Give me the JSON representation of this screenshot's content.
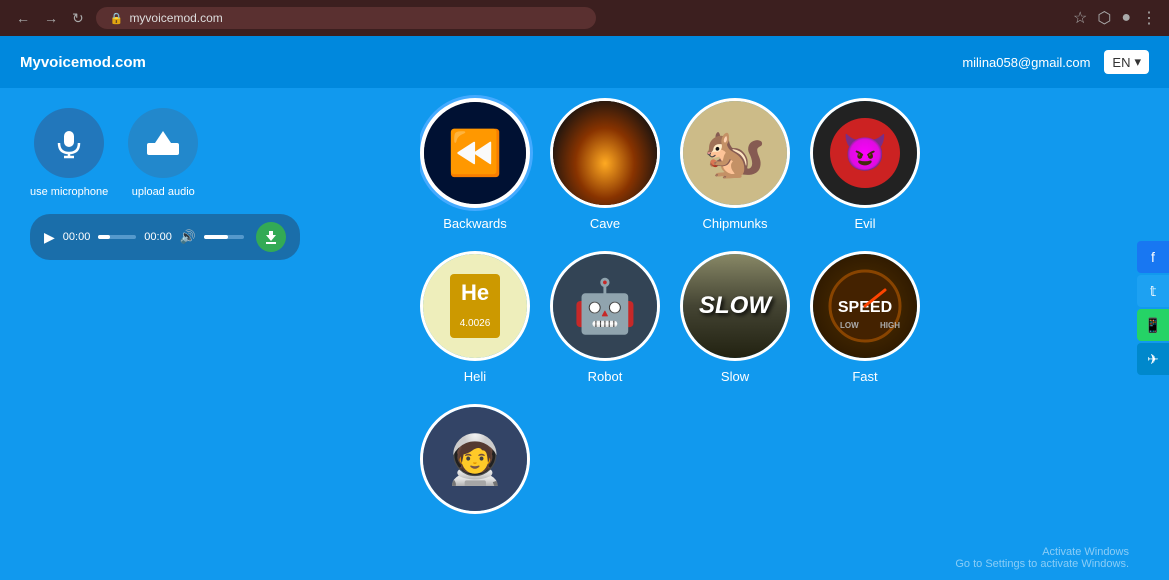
{
  "browser": {
    "url": "myvoicemod.com",
    "extensions": [
      "★",
      "≡",
      "⬡",
      "●"
    ]
  },
  "topbar": {
    "site_title": "Myvoicemod.com",
    "user_email": "milina058@gmail.com",
    "language": "EN"
  },
  "left_panel": {
    "mic_label": "use microphone",
    "upload_label": "upload audio",
    "time_start": "00:00",
    "time_end": "00:00"
  },
  "voices": {
    "row1": [
      {
        "id": "backwards",
        "label": "Backwards",
        "selected": true
      },
      {
        "id": "cave",
        "label": "Cave",
        "selected": false
      },
      {
        "id": "chipmunks",
        "label": "Chipmunks",
        "selected": false
      },
      {
        "id": "evil",
        "label": "Evil",
        "selected": false
      }
    ],
    "row2": [
      {
        "id": "heli",
        "label": "Heli",
        "selected": false
      },
      {
        "id": "robot",
        "label": "Robot",
        "selected": false
      },
      {
        "id": "slow",
        "label": "Slow",
        "selected": false
      },
      {
        "id": "fast",
        "label": "Fast",
        "selected": false
      }
    ],
    "row3": [
      {
        "id": "astronaut",
        "label": "",
        "selected": false
      }
    ]
  },
  "social": {
    "facebook": "f",
    "twitter": "t",
    "whatsapp": "w",
    "telegram": "✈"
  },
  "windows": {
    "activate_line1": "Activate Windows",
    "activate_line2": "Go to Settings to activate Windows."
  }
}
